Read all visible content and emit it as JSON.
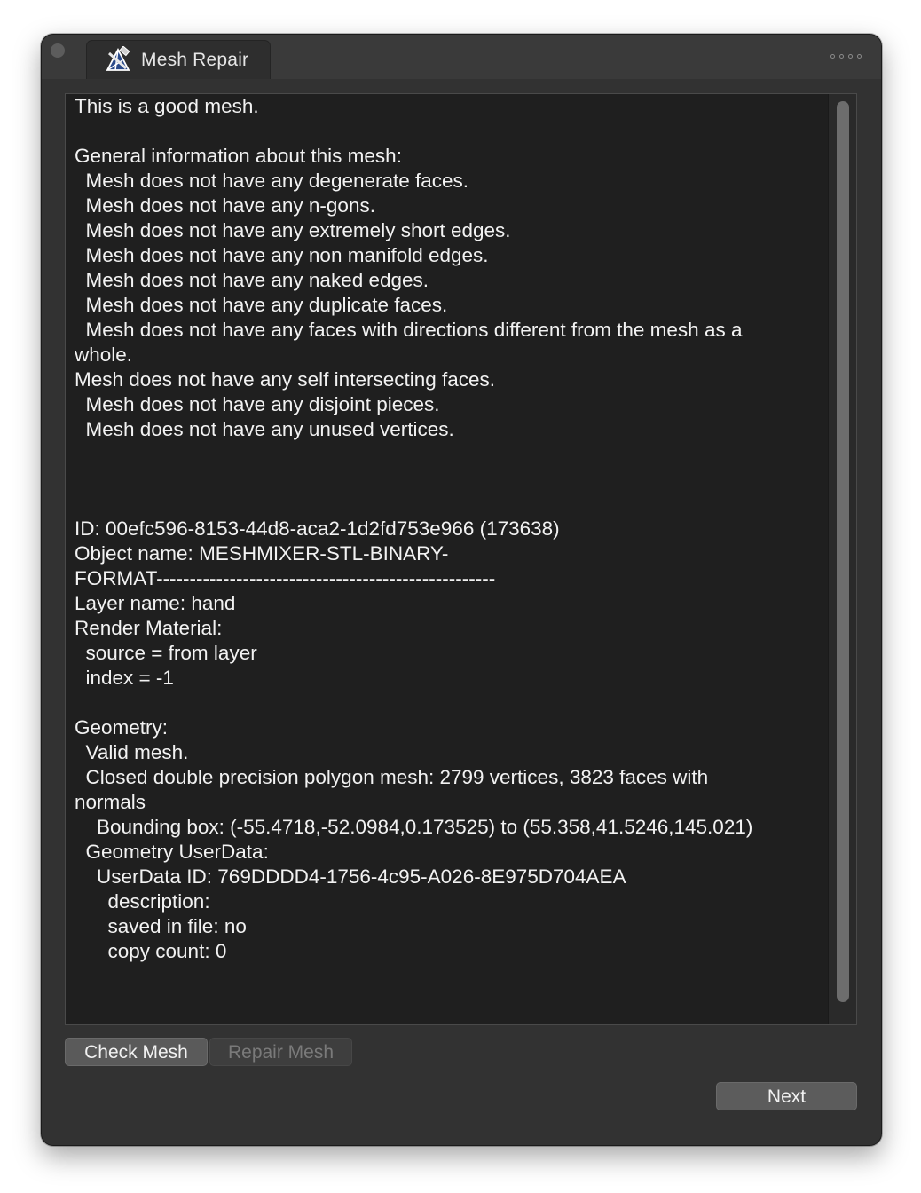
{
  "window": {
    "tab_title": "Mesh Repair",
    "tab_icon": "mesh-repair-icon"
  },
  "report_lines": [
    "This is a good mesh.",
    "",
    "General information about this mesh:",
    "  Mesh does not have any degenerate faces.",
    "  Mesh does not have any n-gons.",
    "  Mesh does not have any extremely short edges.",
    "  Mesh does not have any non manifold edges.",
    "  Mesh does not have any naked edges.",
    "  Mesh does not have any duplicate faces.",
    "  Mesh does not have any faces with directions different from the mesh as a",
    "whole.",
    "Mesh does not have any self intersecting faces.",
    "  Mesh does not have any disjoint pieces.",
    "  Mesh does not have any unused vertices.",
    "",
    "",
    "",
    "ID: 00efc596-8153-44d8-aca2-1d2fd753e966 (173638)",
    "Object name: MESHMIXER-STL-BINARY-",
    "FORMAT---------------------------------------------------",
    "Layer name: hand",
    "Render Material:",
    "  source = from layer",
    "  index = -1",
    "",
    "Geometry:",
    "  Valid mesh.",
    "  Closed double precision polygon mesh: 2799 vertices, 3823 faces with",
    "normals",
    "    Bounding box: (-55.4718,-52.0984,0.173525) to (55.358,41.5246,145.021)",
    "  Geometry UserData:",
    "    UserData ID: 769DDDD4-1756-4c95-A026-8E975D704AEA",
    "      description:",
    "      saved in file: no",
    "      copy count: 0"
  ],
  "buttons": {
    "check_mesh": "Check Mesh",
    "repair_mesh": "Repair Mesh",
    "next": "Next"
  },
  "colors": {
    "window_bg": "#323232",
    "text_bg": "#1f1f1f",
    "text_color": "#f2f2f2",
    "disabled_text": "#7a7a7a"
  }
}
